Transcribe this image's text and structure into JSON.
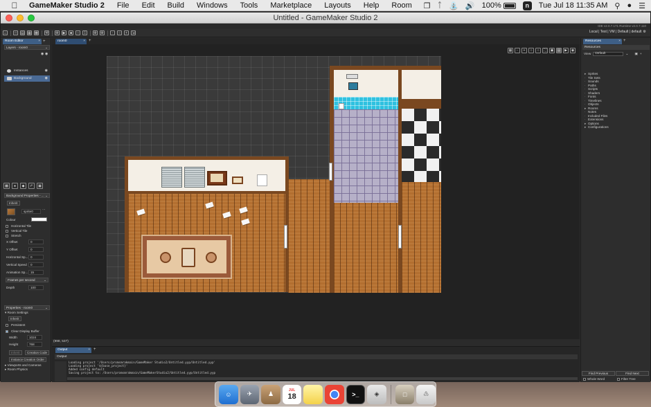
{
  "menubar": {
    "app_name": "GameMaker Studio 2",
    "items": [
      "File",
      "Edit",
      "Build",
      "Windows",
      "Tools",
      "Marketplace",
      "Layouts",
      "Help",
      "Room"
    ],
    "battery": "100%",
    "clock": "Tue Jul 18  11:35 AM"
  },
  "window": {
    "title": "Untitled - GameMaker Studio 2",
    "version_info": "IDE v2.0.7.171 Runtime v2.0.7.110",
    "target_bar": "Local | Test | VM | Default | default"
  },
  "left_panel": {
    "tab_label": "Room Editor",
    "layers_header": "Layers - room0",
    "layers": [
      {
        "name": "Instances"
      },
      {
        "name": "Background"
      }
    ],
    "bg_props_header": "Background Properties - ...",
    "inherit_label": "Inherit",
    "sprite_name": "sprite0",
    "colour_label": "Colour",
    "checks": [
      "Horizontal Tile",
      "Vertical Tile",
      "Stretch"
    ],
    "fields": [
      {
        "label": "X Offset",
        "value": "0"
      },
      {
        "label": "Y Offset",
        "value": "0"
      },
      {
        "label": "Horizontal Sp...",
        "value": "0"
      },
      {
        "label": "Vertical Speed",
        "value": "0"
      },
      {
        "label": "Animation Sp...",
        "value": "15"
      }
    ],
    "fps_dropdown": "Frames per second",
    "depth_label": "Depth",
    "depth_value": "100",
    "properties_header": "Properties - room0",
    "room_settings": "Room Settings",
    "persistent": "Persistent",
    "clear_display": "Clear Display Buffer",
    "width_label": "Width",
    "width_value": "1024",
    "height_label": "Height",
    "height_value": "768",
    "creation_code_btn": "Creation Code",
    "instance_order_btn": "Instance Creation Order",
    "viewports": "Viewports and Cameras",
    "physics": "Room Physics"
  },
  "room_tab": "room0",
  "status_coords": "(998, 537)",
  "output": {
    "tab": "Output",
    "header": "Output",
    "lines": [
      "Loading project '/Users/promsmrakmain/GameMaker Studio2/Untitled.yyp/Untitled.yyp'",
      "Loading project '${base_project}'",
      "Added config default",
      "Saving project to: /Users/promsmrakmain/GameMakerStudio2/Untitled.yyp/Untitled.yyp"
    ]
  },
  "resources": {
    "tab": "Resources",
    "header": "Resources",
    "view_label": "View",
    "view_value": "Default",
    "items": [
      {
        "label": "Sprites",
        "expand": true
      },
      {
        "label": "Tile Sets",
        "expand": false
      },
      {
        "label": "Sounds",
        "expand": false
      },
      {
        "label": "Paths",
        "expand": false
      },
      {
        "label": "Scripts",
        "expand": false
      },
      {
        "label": "Shaders",
        "expand": false
      },
      {
        "label": "Fonts",
        "expand": false
      },
      {
        "label": "Timelines",
        "expand": false
      },
      {
        "label": "Objects",
        "expand": false
      },
      {
        "label": "Rooms",
        "expand": true
      },
      {
        "label": "Notes",
        "expand": false
      },
      {
        "label": "Included Files",
        "expand": false
      },
      {
        "label": "Extensions",
        "expand": false
      },
      {
        "label": "Options",
        "expand": true
      },
      {
        "label": "Configurations",
        "expand": true
      }
    ],
    "search_label": "Search...",
    "whole_word": "Whole Word",
    "filter_tree": "Filter Tree",
    "find_previous": "Find Previous",
    "find_next": "Find Next"
  },
  "dock": {
    "calendar_month": "JUL",
    "calendar_day": "18"
  }
}
